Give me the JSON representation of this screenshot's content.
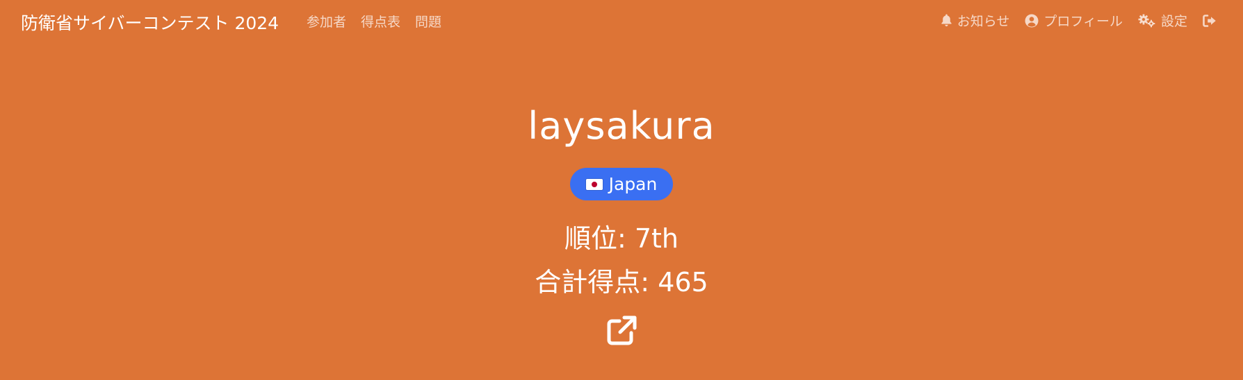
{
  "navbar": {
    "brand": "防衛省サイバーコンテスト 2024",
    "links": [
      {
        "label": "参加者"
      },
      {
        "label": "得点表"
      },
      {
        "label": "問題"
      }
    ],
    "right": {
      "notifications_label": "お知らせ",
      "profile_label": "プロフィール",
      "settings_label": "設定"
    }
  },
  "profile": {
    "username": "laysakura",
    "country": "Japan",
    "rank_label": "順位",
    "rank_value": "7th",
    "score_label": "合計得点",
    "score_value": "465"
  },
  "icons": {
    "notifications": "bell-icon",
    "profile": "user-circle-icon",
    "settings": "gears-icon",
    "logout": "sign-out-icon",
    "external": "external-link-icon",
    "flag": "japan-flag-icon"
  },
  "colors": {
    "background": "#dd7436",
    "badge": "#3a6ff2",
    "text": "#ffffff"
  }
}
